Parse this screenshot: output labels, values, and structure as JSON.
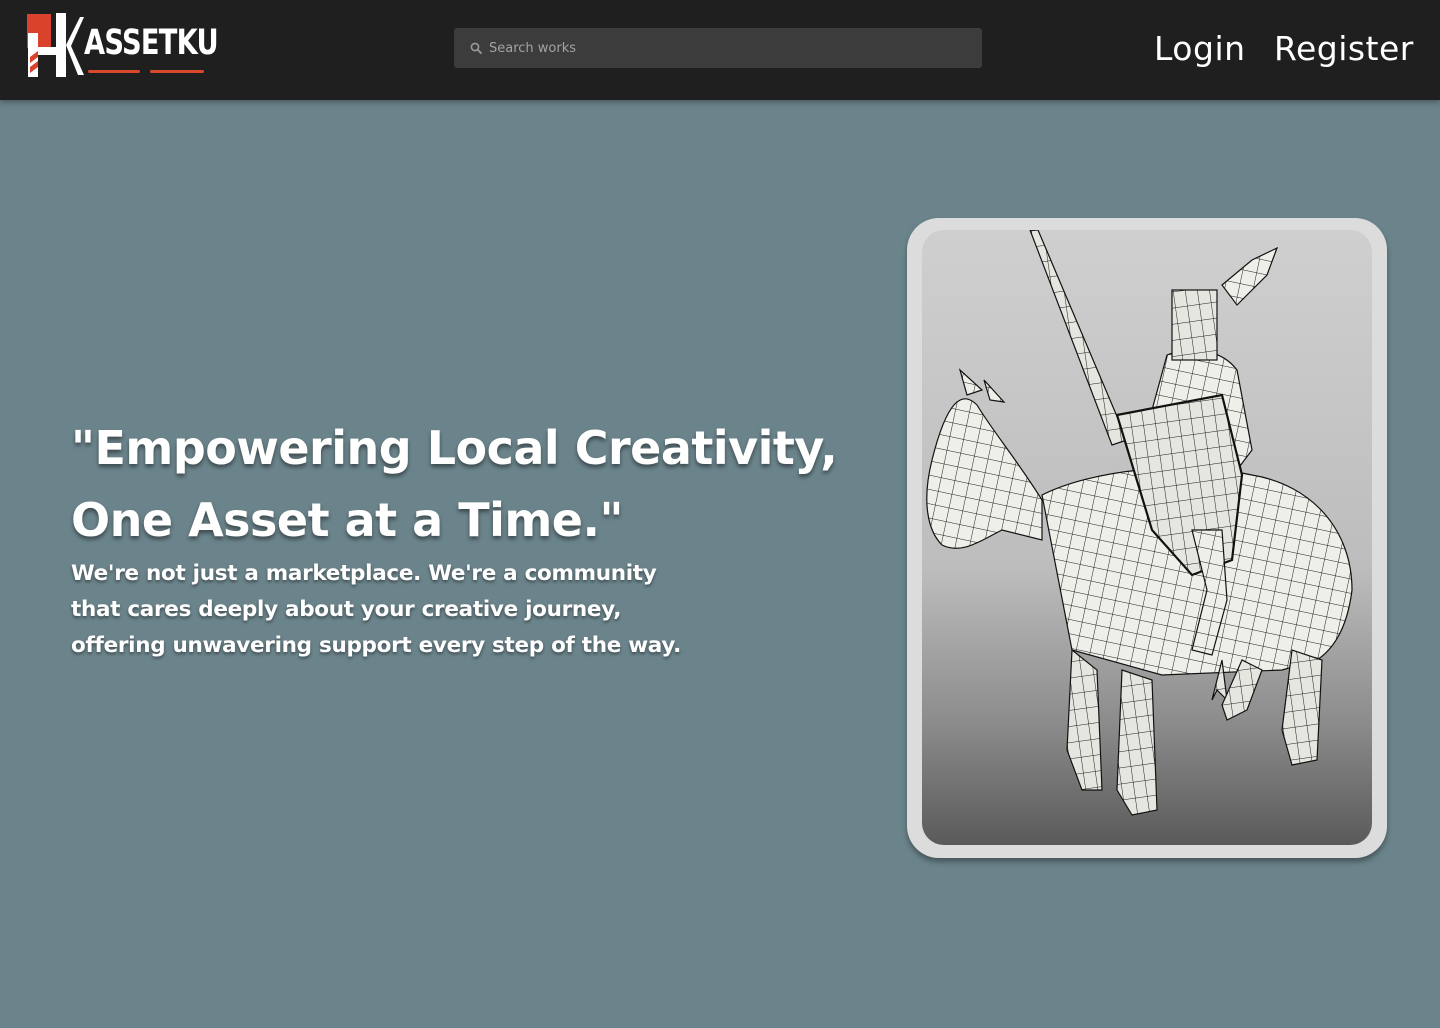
{
  "header": {
    "logo": {
      "text": "ASSETKU",
      "mark_letters": "HK"
    },
    "search": {
      "placeholder": "Search works",
      "icon": "search-icon"
    },
    "nav": {
      "login_label": "Login",
      "register_label": "Register"
    }
  },
  "hero": {
    "headline_line1": "\"Empowering Local Creativity,",
    "headline_line2": "One Asset at a Time.\"",
    "subhead_line1": "We're not just a marketplace. We're a community",
    "subhead_line2": "that cares deeply about your creative journey,",
    "subhead_line3": "offering unwavering support every step of the way."
  },
  "showcase": {
    "image": "wireframe-knight-on-horse-3d-model"
  },
  "colors": {
    "header_bg": "#1f1f1f",
    "page_bg": "#6b848b",
    "accent": "#d94a2c",
    "search_bg": "#3c3c3c",
    "card_frame": "#dcdcdc"
  }
}
